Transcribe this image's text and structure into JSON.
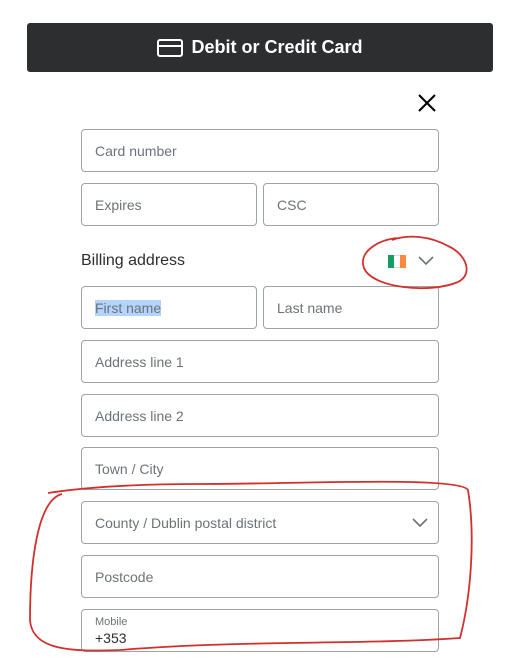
{
  "header": {
    "title": "Debit or Credit Card",
    "icon": "credit-card-icon"
  },
  "close": {
    "icon": "close-icon"
  },
  "card": {
    "number_placeholder": "Card number",
    "expires_placeholder": "Expires",
    "csc_placeholder": "CSC"
  },
  "billing": {
    "title": "Billing address",
    "country_flag": [
      "#169b62",
      "#ffffff",
      "#ff883e"
    ],
    "first_name_placeholder": "First name",
    "last_name_placeholder": "Last name",
    "address1_placeholder": "Address line 1",
    "address2_placeholder": "Address line 2",
    "town_placeholder": "Town / City",
    "county_placeholder": "County / Dublin postal district",
    "postcode_placeholder": "Postcode",
    "mobile_label": "Mobile",
    "mobile_value": "+353"
  },
  "colors": {
    "dark": "#2c2e2f",
    "annotation": "#d0312d",
    "selection": "#b3d4fc"
  }
}
